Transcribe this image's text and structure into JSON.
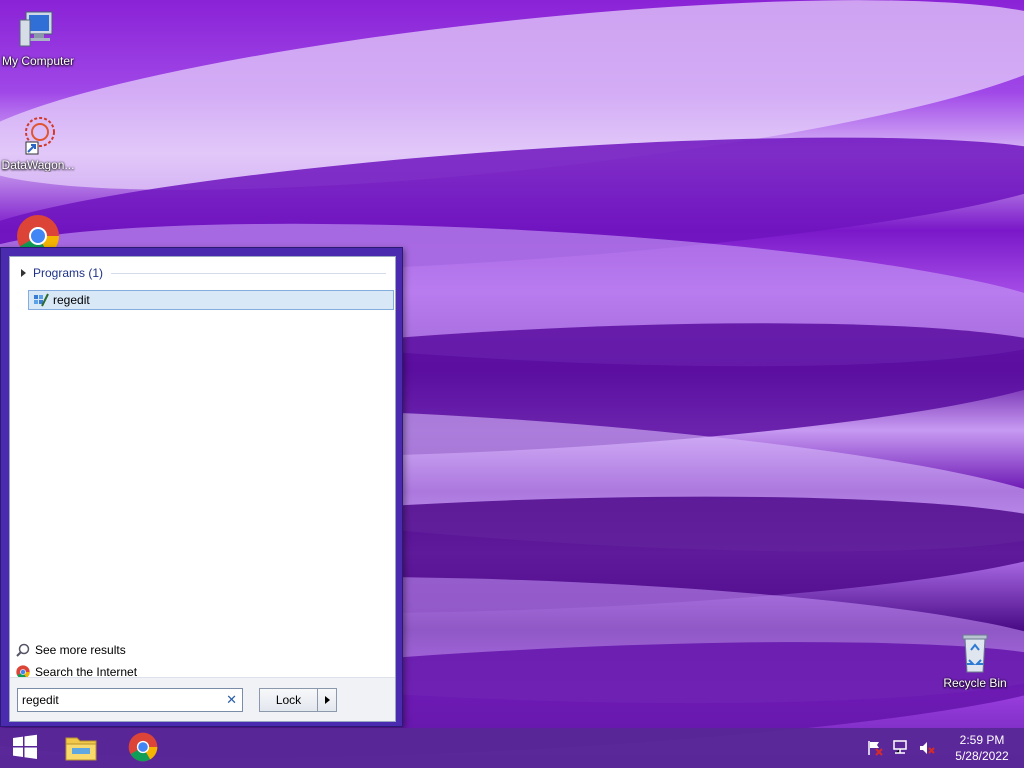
{
  "desktop": {
    "icons": [
      {
        "label": "My Computer",
        "icon": "computer-icon"
      },
      {
        "label": "DataWagon...",
        "icon": "datawagon-shortcut-icon"
      },
      {
        "label": "",
        "icon": "chrome-icon"
      },
      {
        "label": "Recycle Bin",
        "icon": "recycle-bin-icon"
      }
    ]
  },
  "start_menu": {
    "section_label": "Programs (1)",
    "results": [
      {
        "label": "regedit",
        "icon": "regedit-icon"
      }
    ],
    "see_more": "See more results",
    "search_internet": "Search the Internet",
    "search_value": "regedit",
    "power_label": "Lock"
  },
  "taskbar": {
    "items": [
      {
        "icon": "windows-start-icon"
      },
      {
        "icon": "file-explorer-icon"
      },
      {
        "icon": "chrome-icon"
      }
    ],
    "tray": {
      "icons": [
        "action-center-flag-icon",
        "network-icon",
        "volume-muted-icon"
      ],
      "time": "2:59 PM",
      "date": "5/28/2022"
    }
  },
  "colors": {
    "start_frame": "#4a2bb0",
    "selection_bg": "#d9e8f7",
    "link_blue": "#1e3287",
    "taskbar": "#582896"
  }
}
